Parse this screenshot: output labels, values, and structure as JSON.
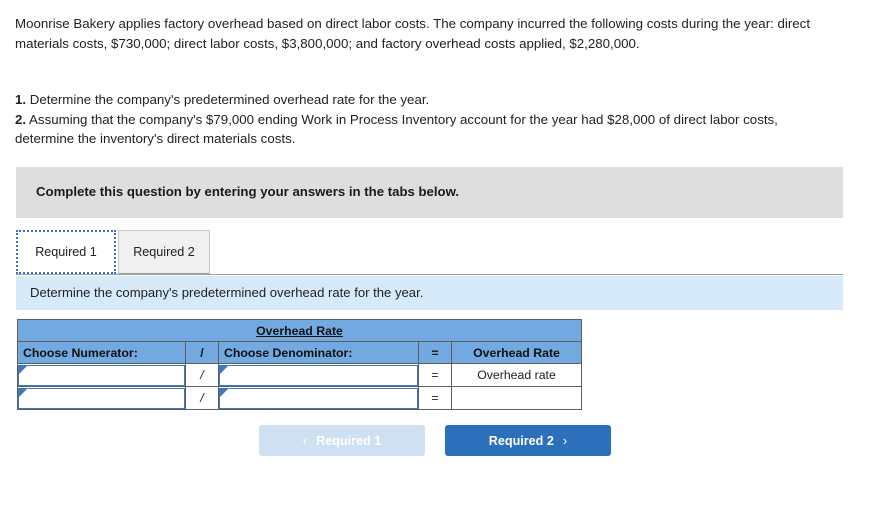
{
  "problem": {
    "statement": "Moonrise Bakery applies factory overhead based on direct labor costs. The company incurred the following costs during the year: direct materials costs, $730,000; direct labor costs, $3,800,000; and factory overhead costs applied, $2,280,000."
  },
  "requirements": [
    {
      "number": "1.",
      "text": " Determine the company's predetermined overhead rate for the year."
    },
    {
      "number": "2.",
      "text": " Assuming that the company's $79,000 ending Work in Process Inventory account for the year had $28,000 of direct labor costs, determine the inventory's direct materials costs."
    }
  ],
  "banner": {
    "text": "Complete this question by entering your answers in the tabs below."
  },
  "tabs": [
    {
      "label": "Required 1",
      "active": true
    },
    {
      "label": "Required 2",
      "active": false
    }
  ],
  "instruction": {
    "text": "Determine the company's predetermined overhead rate for the year."
  },
  "table": {
    "title": "Overhead Rate",
    "headers": {
      "numerator": "Choose Numerator:",
      "slash": "/",
      "denominator": "Choose Denominator:",
      "equals": "=",
      "result": "Overhead Rate"
    },
    "rows": [
      {
        "numerator_value": "",
        "slash": "/",
        "denominator_value": "",
        "equals": "=",
        "result": "Overhead rate"
      },
      {
        "numerator_value": "",
        "slash": "/",
        "denominator_value": "",
        "equals": "=",
        "result": ""
      }
    ]
  },
  "nav": {
    "prev_label": "Required 1",
    "prev_icon": "chevron-left-icon",
    "prev_chevron": "‹",
    "next_label": "Required 2",
    "next_icon": "chevron-right-icon",
    "next_chevron": "›"
  },
  "colors": {
    "banner_gray": "#dedede",
    "instruction_blue": "#d7eafa",
    "table_header_blue": "#72a9e0",
    "button_active_blue": "#2c6fbb",
    "button_disabled_blue": "#cfe0f2",
    "input_border_blue": "#3b78c0",
    "tab_focus_blue": "#3b73c4"
  }
}
